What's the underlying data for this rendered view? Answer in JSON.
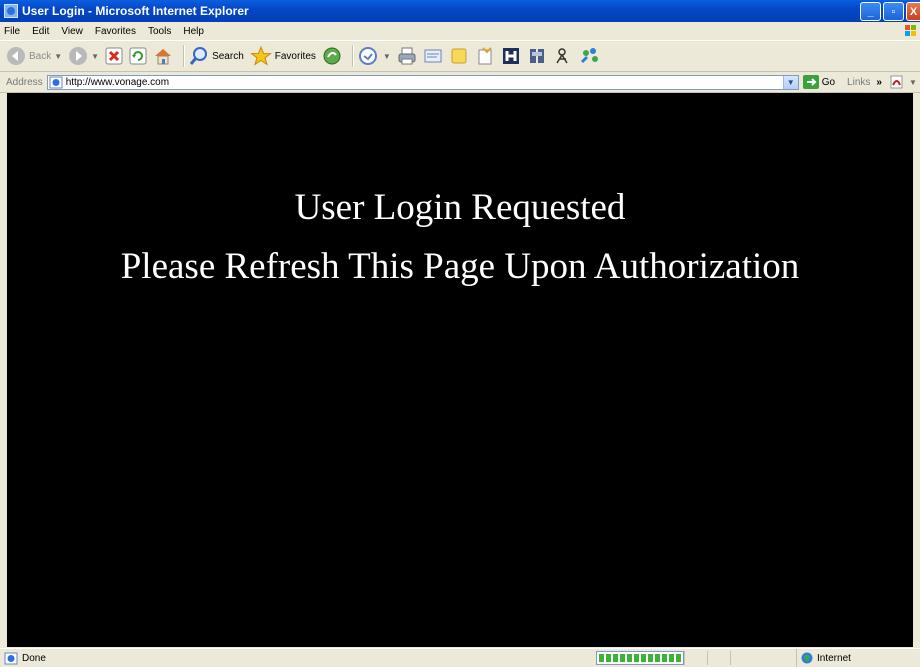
{
  "window": {
    "title": "User Login - Microsoft Internet Explorer",
    "icon": "ie-page-icon",
    "controls": [
      "minimize",
      "maximize",
      "close"
    ]
  },
  "menu": [
    "File",
    "Edit",
    "View",
    "Favorites",
    "Tools",
    "Help"
  ],
  "toolbar": {
    "back_label": "Back",
    "search_label": "Search",
    "favorites_label": "Favorites"
  },
  "address": {
    "label": "Address",
    "url": "http://www.vonage.com",
    "go_label": "Go",
    "links_label": "Links"
  },
  "page": {
    "line1": "User Login Requested",
    "line2": "Please Refresh This Page Upon Authorization",
    "background": "#000000",
    "text_color": "#FFFFFF"
  },
  "status": {
    "text": "Done",
    "progress": 1.0,
    "zone": "Internet"
  }
}
